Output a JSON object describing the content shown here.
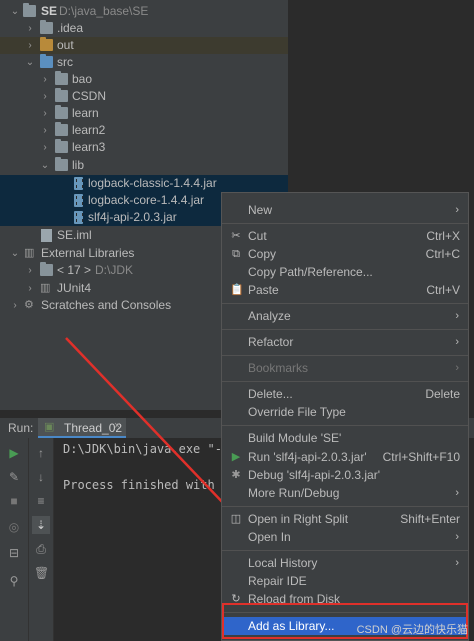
{
  "tree": {
    "root": {
      "name": "SE",
      "path": "D:\\java_base\\SE"
    },
    "idea": ".idea",
    "out": "out",
    "src": "src",
    "folders": [
      "bao",
      "CSDN",
      "learn",
      "learn2",
      "learn3"
    ],
    "lib": "lib",
    "jars": [
      "logback-classic-1.4.4.jar",
      "logback-core-1.4.4.jar",
      "slf4j-api-2.0.3.jar"
    ],
    "iml": "SE.iml",
    "external_libraries": "External Libraries",
    "jdk": {
      "version": "< 17 >",
      "path": "D:\\JDK"
    },
    "junit": "JUnit4",
    "scratches": "Scratches and Consoles"
  },
  "run": {
    "label": "Run:",
    "tab": "Thread_02",
    "console_lines": [
      "D:\\JDK\\bin\\java.exe \"-ja",
      "",
      "Process finished with ex"
    ]
  },
  "menu": {
    "items": [
      {
        "label": "New",
        "shortcut": "",
        "submenu": true
      },
      {
        "label": "Cut",
        "shortcut": "Ctrl+X"
      },
      {
        "label": "Copy",
        "shortcut": "Ctrl+C"
      },
      {
        "label": "Copy Path/Reference...",
        "shortcut": ""
      },
      {
        "label": "Paste",
        "shortcut": "Ctrl+V"
      },
      {
        "label": "Analyze",
        "shortcut": "",
        "submenu": true
      },
      {
        "label": "Refactor",
        "shortcut": "",
        "submenu": true
      },
      {
        "label": "Bookmarks",
        "shortcut": "",
        "submenu": true
      },
      {
        "label": "Delete...",
        "shortcut": "Delete"
      },
      {
        "label": "Override File Type",
        "shortcut": ""
      },
      {
        "label": "Build Module 'SE'",
        "shortcut": ""
      },
      {
        "label": "Run 'slf4j-api-2.0.3.jar'",
        "shortcut": "Ctrl+Shift+F10"
      },
      {
        "label": "Debug 'slf4j-api-2.0.3.jar'",
        "shortcut": ""
      },
      {
        "label": "More Run/Debug",
        "shortcut": "",
        "submenu": true
      },
      {
        "label": "Open in Right Split",
        "shortcut": "Shift+Enter"
      },
      {
        "label": "Open In",
        "shortcut": "",
        "submenu": true
      },
      {
        "label": "Local History",
        "shortcut": "",
        "submenu": true
      },
      {
        "label": "Repair IDE",
        "shortcut": ""
      },
      {
        "label": "Reload from Disk",
        "shortcut": ""
      },
      {
        "label": "Add as Library...",
        "shortcut": ""
      }
    ]
  },
  "watermark": "CSDN @云边的快乐猫",
  "colors": {
    "accent": "#2f65ca",
    "annotation": "#e0302a",
    "selection": "#0d293e"
  }
}
